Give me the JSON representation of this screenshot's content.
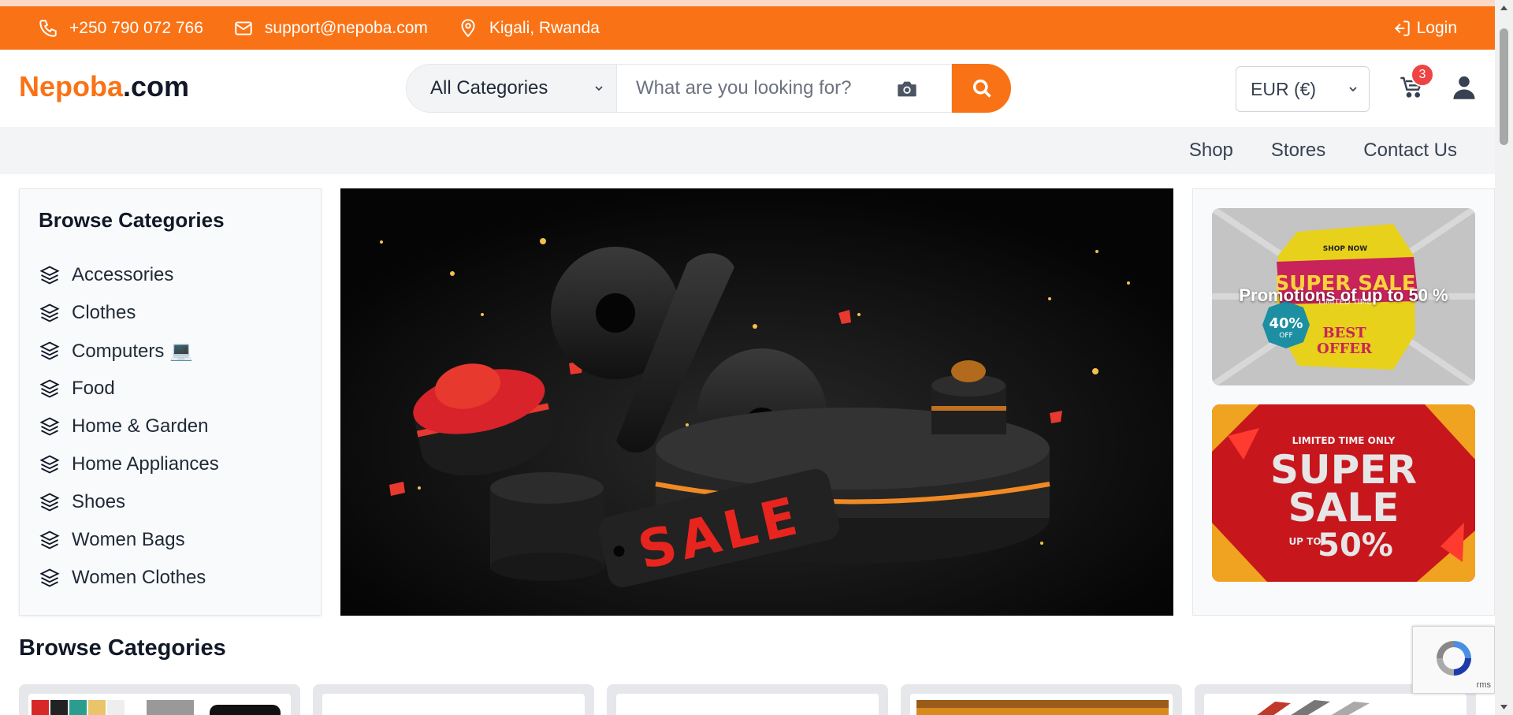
{
  "topbar": {
    "phone": "+250 790 072 766",
    "email": "support@nepoba.com",
    "location": "Kigali, Rwanda",
    "login": "Login"
  },
  "header": {
    "logo_brand": "Nepoba",
    "logo_tld": ".com",
    "category_select": "All Categories",
    "search_placeholder": "What are you looking for?",
    "currency": "EUR (€)",
    "cart_count": "3"
  },
  "nav": {
    "items": [
      {
        "label": "Shop"
      },
      {
        "label": "Stores"
      },
      {
        "label": "Contact Us"
      }
    ]
  },
  "sidebar": {
    "title": "Browse Categories",
    "items": [
      {
        "label": "Accessories"
      },
      {
        "label": "Clothes"
      },
      {
        "label": "Computers 💻"
      },
      {
        "label": "Food"
      },
      {
        "label": "Home & Garden"
      },
      {
        "label": "Home Appliances"
      },
      {
        "label": "Shoes"
      },
      {
        "label": "Women Bags"
      },
      {
        "label": "Women Clothes"
      }
    ]
  },
  "hero": {
    "sale_text": "SALE"
  },
  "promos": {
    "promo1_label": "Promotions of up to 50 %",
    "promo1_shop_now": "SHOP NOW",
    "promo1_headline": "SUPER SALE",
    "promo1_limited": "LIMITED TIME",
    "promo1_badge": "40%",
    "promo1_badge_off": "OFF",
    "promo1_best": "BEST",
    "promo1_offer": "OFFER",
    "promo2_limited": "LIMITED TIME ONLY",
    "promo2_super": "SUPER",
    "promo2_sale": "SALE",
    "promo2_upto": "UP TO",
    "promo2_pct": "50%"
  },
  "section": {
    "title": "Browse Categories"
  },
  "recaptcha": {
    "terms": "rms"
  },
  "colors": {
    "accent": "#f97316",
    "badge": "#ef4444"
  }
}
